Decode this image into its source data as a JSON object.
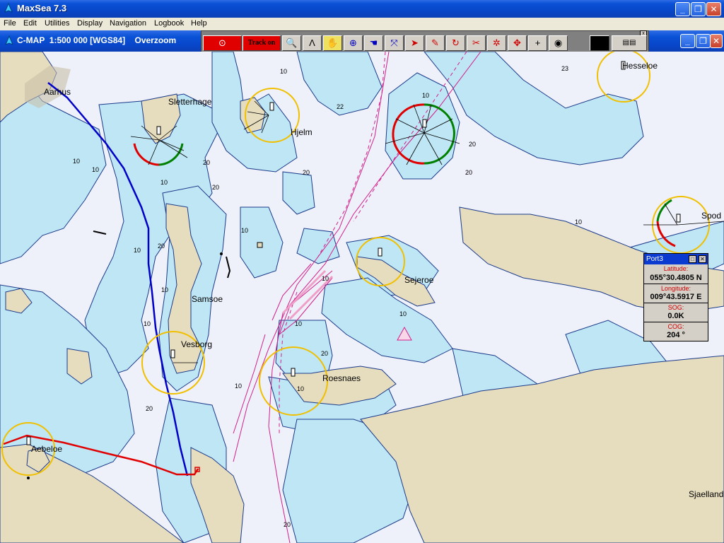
{
  "window": {
    "title": "MaxSea 7.3",
    "buttons": {
      "minimize": "_",
      "restore": "❐",
      "close": "✕"
    }
  },
  "menu": [
    "File",
    "Edit",
    "Utilities",
    "Display",
    "Navigation",
    "Logbook",
    "Help"
  ],
  "chart_window": {
    "title": "C-MAP  1:500 000 [WGS84]    Overzoom"
  },
  "toolbar": {
    "track_label": "Track on",
    "tools": [
      "record-icon",
      "track-on",
      "zoom-icon",
      "compass-icon",
      "hand-icon",
      "crosshair-icon",
      "grab-icon",
      "route-icon",
      "pointer-icon",
      "pencil-icon",
      "rotate-icon",
      "scissors-icon",
      "target-icon",
      "move-icon",
      "plus-icon",
      "circle-icon"
    ]
  },
  "places": {
    "aarhus": "Aarhus",
    "sletterhage": "Sletterhage",
    "hjelm": "Hjelm",
    "hesseloe": "Hesseloe",
    "samsoe": "Samsoe",
    "vesborg": "Vesborg",
    "sejeroe": "Sejeroe",
    "roesnaes": "Roesnaes",
    "aebeloe": "Aebeloe",
    "sjaelland": "Sjaelland",
    "spodsbjerg": "Spod"
  },
  "depths": {
    "d10": "10",
    "d20": "20",
    "d22": "22",
    "d23": "23"
  },
  "port_panel": {
    "title": "Port3",
    "latitude_label": "Latitude:",
    "latitude": "055°30.4805 N",
    "longitude_label": "Longitude:",
    "longitude": "009°43.5917 E",
    "sog_label": "SOG:",
    "sog": "0.0K",
    "cog_label": "COG:",
    "cog": "204 °"
  },
  "colors": {
    "land": "#e6dcbe",
    "deep_water": "#eef0fa",
    "shallow_water": "#bfe6f5",
    "route_blue": "#0000c8",
    "route_red": "#e00000",
    "light_ring": "#f0c000"
  }
}
